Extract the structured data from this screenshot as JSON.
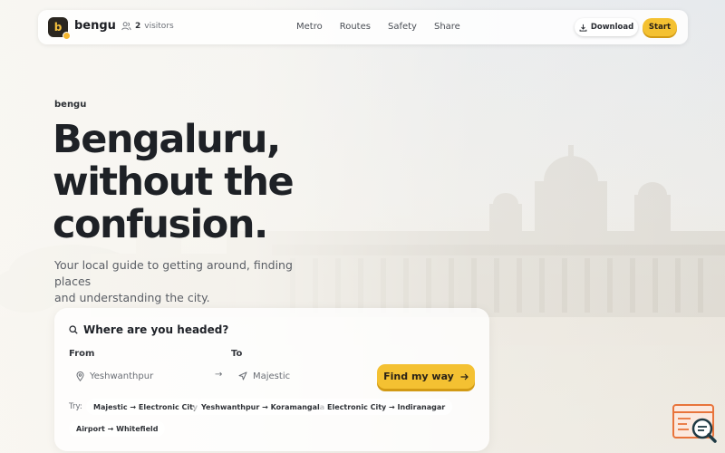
{
  "nav": {
    "logo_letter": "b",
    "brand": "bengu",
    "visitors_count": "2",
    "visitors_label": "visitors",
    "links": [
      "Metro",
      "Routes",
      "Safety",
      "Share"
    ],
    "download_label": "Download",
    "start_label": "Start"
  },
  "hero": {
    "eyebrow": "bengu",
    "headline": [
      "Bengaluru,",
      "without the",
      "confusion."
    ],
    "subtitle_lines": [
      "Your local guide to getting around, finding places",
      "and understanding the city."
    ]
  },
  "search": {
    "title": "Where are you headed?",
    "from_label": "From",
    "to_label": "To",
    "from_value": "Yeshwanthpur",
    "to_value": "Majestic",
    "find_label": "Find my way",
    "try_label": "Try:",
    "suggestions": [
      "Majestic → Electronic City",
      "Yeshwanthpur → Koramangala",
      "Electronic City → Indiranagar",
      "Airport → Whitefield"
    ]
  },
  "colors": {
    "accent": "#f4c132",
    "accent_shadow": "#d29a14",
    "dark": "#1e2126",
    "widget_accent": "#e8743b"
  },
  "icons": {
    "visitors": "users-icon",
    "download": "download-icon",
    "search": "search-icon",
    "from": "location-pin-icon",
    "to": "navigation-arrow-icon",
    "swap": "arrow-right-icon",
    "find": "arrow-right-icon",
    "widget": "chat-search-icon"
  }
}
